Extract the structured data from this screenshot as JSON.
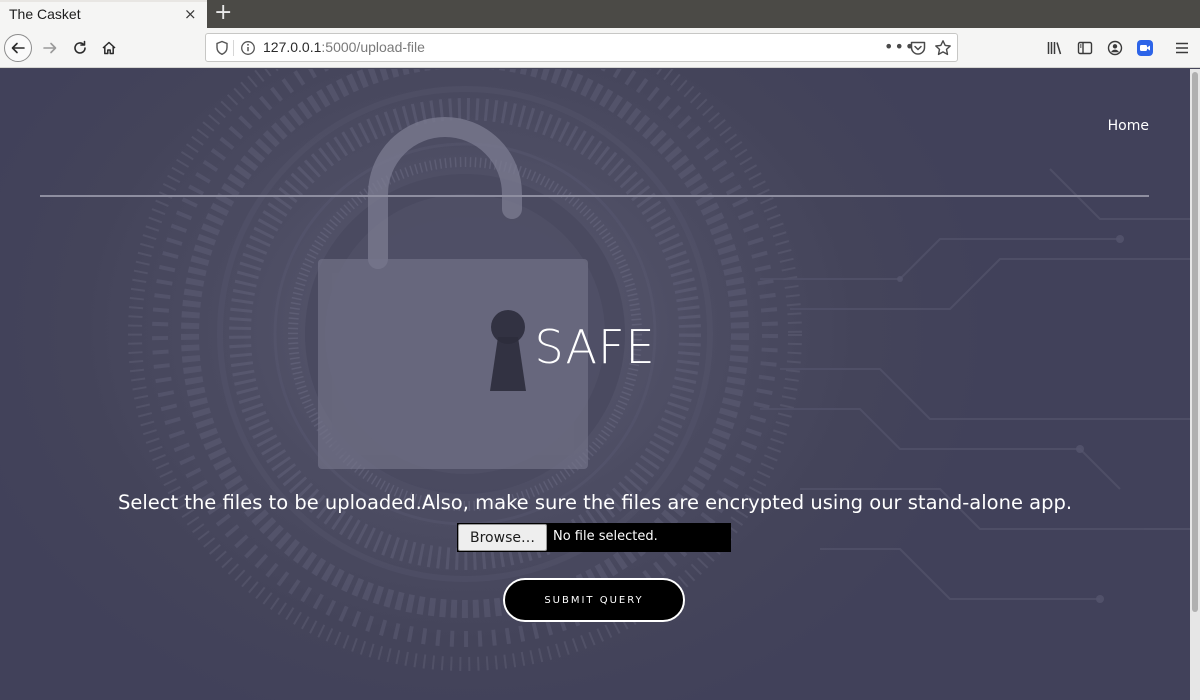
{
  "browser": {
    "tab_title": "The Casket",
    "tab_close": "×",
    "new_tab": "+",
    "url_host": "127.0.0.1",
    "url_rest": ":5000/upload-file",
    "url_more": "•••",
    "icons": [
      "back-icon",
      "forward-icon",
      "reload-icon",
      "home-icon",
      "shield-icon",
      "info-icon",
      "pocket-icon",
      "bookmark-star-icon",
      "library-icon",
      "sidebar-icon",
      "account-icon",
      "extension-icon",
      "menu-icon"
    ]
  },
  "page": {
    "nav": {
      "home_label": "Home"
    },
    "hero_title": "SAFE",
    "instruction": "Select the files to be uploaded.Also, make sure the files are encrypted using our stand-alone app.",
    "file_input": {
      "browse_label": "Browse…",
      "status": "No file selected."
    },
    "submit_label": "SUBMIT QUERY",
    "colors": {
      "background": "#45455a",
      "accent": "#ffffff",
      "button": "#000000"
    }
  }
}
